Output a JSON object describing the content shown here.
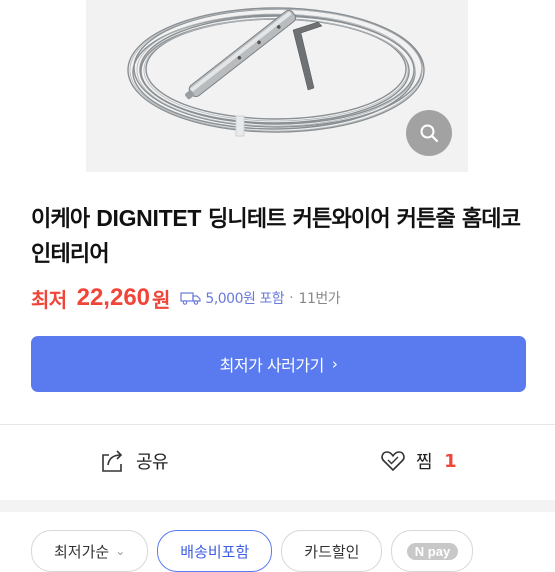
{
  "product": {
    "title_prefix": "이케아",
    "title_brand": "DIGNITET",
    "title_rest": "딩니테트 커튼와이어 커튼줄 홈데코 인테리어"
  },
  "price": {
    "label": "최저",
    "value": "22,260",
    "unit": "원",
    "shipping": "5,000원 포함",
    "separator": "·",
    "mall": "11번가"
  },
  "cta": {
    "label": "최저가 사러가기",
    "chevron": "›"
  },
  "actions": {
    "share_label": "공유",
    "zzim_label": "찜",
    "zzim_count": "1"
  },
  "filters": {
    "sort_label": "최저가순",
    "sort_chevron": "⌄",
    "chips": [
      "배송비포함",
      "카드할인"
    ],
    "npay_label": "N pay"
  },
  "colors": {
    "accent": "#5a7bf0",
    "price": "#f0463a",
    "shipping": "#6a7ad8"
  }
}
